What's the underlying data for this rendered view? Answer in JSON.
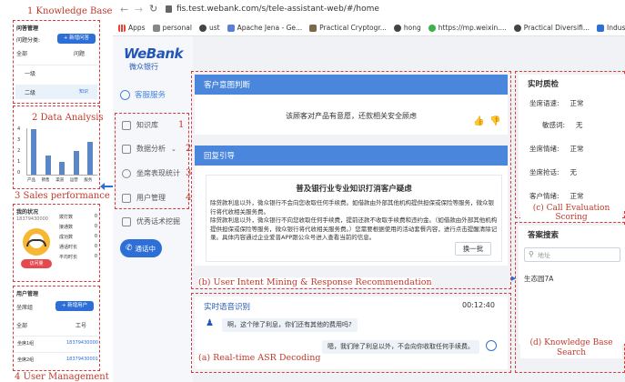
{
  "annotations": {
    "knowledge_base": "1 Knowledge Base",
    "data_analysis": "2 Data Analysis",
    "sales_performance": "3 Sales performance",
    "user_management": "4 User Management",
    "call_evaluation": "(c) Call Evaluation Scoring",
    "intent_mining": "(b) User Intent Mining  & Response Recommendation",
    "asr": "(a) Real-time ASR Decoding",
    "kb_search": "(d) Knowledge Base Search",
    "menu_nums": [
      "1",
      "2",
      "3",
      "4"
    ]
  },
  "thumb_kb": {
    "title": "问答管理",
    "group_label": "问题分类:",
    "add_button": "+ 新增问答",
    "filter": "全部",
    "col": "问题",
    "row1": "一级",
    "row2": "二级",
    "row_action": "知识"
  },
  "thumb_chart": {
    "values": [
      4.2,
      1.8,
      1.2,
      2.2,
      3.0
    ],
    "yticks": [
      "4",
      "3",
      "2",
      "1",
      "0"
    ],
    "categories": [
      "产品",
      "销售",
      "渠道",
      "运营",
      "服务"
    ]
  },
  "thumb_sales": {
    "title": "我的状况",
    "phone": "18379430000",
    "stats": [
      "拨打数",
      "接通数",
      "成功数",
      "通话时长",
      "平均时长"
    ],
    "stat_values": [
      "0",
      "0",
      "0",
      "0",
      "0"
    ],
    "badge": "访问量"
  },
  "thumb_user": {
    "title": "用户管理",
    "group_label": "坐席组",
    "add_button": "+ 新增用户",
    "col1": "全部",
    "col2": "工号",
    "rows": [
      "坐席1组",
      "坐席2组"
    ],
    "phones": [
      "18379430000",
      "18379430001"
    ]
  },
  "browser": {
    "url": "fis.test.webank.com/s/tele-assistant-web/#/home",
    "bookmarks": [
      "Apps",
      "personal",
      "ust",
      "Apache Jena - Ge...",
      "Practical Cryptogr...",
      "hong",
      "https://mp.weixin....",
      "Practical Diversifi...",
      "Industry an"
    ]
  },
  "app": {
    "logo": "WeBank",
    "logo_sub": "微众银行",
    "service": "客服服务",
    "menu": [
      "知识库",
      "数据分析",
      "坐席表现统计",
      "用户管理"
    ],
    "excellent": "优秀话术挖掘",
    "calling": "通话中",
    "intent_header": "客户意图判断",
    "intent_text": "该顾客对产品有意愿，还款相关安全顾虑",
    "guide_header": "回复引导",
    "guide_title": "普及银行业专业知识打消客户疑虑",
    "guide_body": "除贷款利息以外，微众银行不会向您收取任何手续费。如借款由外部其他机构提供担保或保险等服务，微众银行将代收相关服务费。\n除贷款利息以外，微众银行不向您收取任何手续费，提前还款不收取手续费和违约金。（如借款由外部其他机构提供担保或保险等服务，微众银行将代收相关服务费。）您需要根据使用的活动套餐内容，进行点击提醒清除记录。具体内容通过企业爱普APP跟公众号进入查看当前的信息。",
    "switch_button": "换一批",
    "asr_header": "实时语音识别",
    "asr_time": "00:12:40",
    "asr_customer": "啊，这个除了利息，你们还有其他的费用吗?",
    "asr_agent": "嗯，我们除了利息以外，不会向你收取任何手续费。",
    "quality_header": "实时质检",
    "quality_rows": [
      {
        "label": "坐席语速:",
        "value": "正常"
      },
      {
        "label": "敏感词:",
        "value": "无"
      },
      {
        "label": "坐席情绪:",
        "value": "正常"
      },
      {
        "label": "坐席抢话:",
        "value": "无"
      },
      {
        "label": "客户情绪:",
        "value": "正常"
      }
    ],
    "kb_header": "答案搜索",
    "kb_placeholder": "地址",
    "kb_result": "生态园7A"
  }
}
